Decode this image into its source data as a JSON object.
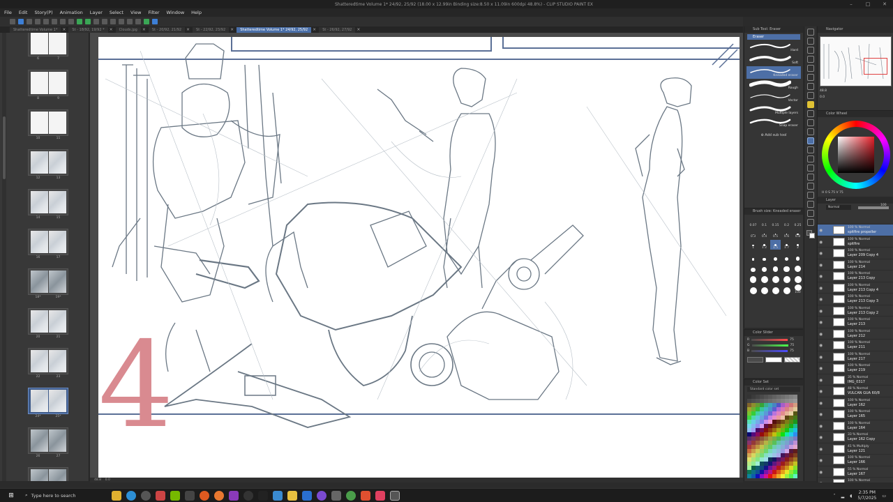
{
  "window": {
    "title": "Shatteredtime Volume 1* 24/92, 25/92 (18.00 x 12.99in Binding size:8.50 x 11.09in 600dpi 48.8%) - CLIP STUDIO PAINT EX"
  },
  "menu": [
    "File",
    "Edit",
    "Story(P)",
    "Animation",
    "Layer",
    "Select",
    "View",
    "Filter",
    "Window",
    "Help"
  ],
  "tabs": [
    {
      "label": "Shatteredtime Volume 1*",
      "active": false
    },
    {
      "label": "St - 18/92, 19/92 *",
      "active": false
    },
    {
      "label": "Clouds.jpg",
      "active": false
    },
    {
      "label": "St - 20/92, 21/92",
      "active": false
    },
    {
      "label": "St - 22/92, 23/92",
      "active": false
    },
    {
      "label": "Shatteredtime Volume 1* 24/92, 25/92",
      "active": true
    },
    {
      "label": "St - 26/92, 27/92",
      "active": false
    }
  ],
  "pages": [
    {
      "labels": [
        "6",
        "7"
      ],
      "style": "blank",
      "active": false
    },
    {
      "labels": [
        "8",
        "9"
      ],
      "style": "blank",
      "active": false
    },
    {
      "labels": [
        "10",
        "11"
      ],
      "style": "blank",
      "active": false
    },
    {
      "labels": [
        "12",
        "13"
      ],
      "style": "sketch",
      "active": false
    },
    {
      "labels": [
        "14",
        "15"
      ],
      "style": "sketch",
      "active": false
    },
    {
      "labels": [
        "16",
        "17"
      ],
      "style": "sketch",
      "active": false
    },
    {
      "labels": [
        "18*",
        "19*"
      ],
      "style": "dark",
      "active": false
    },
    {
      "labels": [
        "20",
        "21"
      ],
      "style": "sketch",
      "active": false
    },
    {
      "labels": [
        "22",
        "23"
      ],
      "style": "sketch",
      "active": false
    },
    {
      "labels": [
        "24*",
        "25*"
      ],
      "style": "sketch",
      "active": true
    },
    {
      "labels": [
        "26",
        "27"
      ],
      "style": "dark",
      "active": false
    },
    {
      "labels": [
        "",
        ""
      ],
      "style": "dark",
      "active": false
    }
  ],
  "canvas": {
    "page_number_mark": "4",
    "status_zoom": "48.8",
    "status_angle": "0.0"
  },
  "subtool": {
    "header": "Sub Tool: Eraser",
    "group": "Eraser",
    "items": [
      {
        "name": "Hard",
        "selected": false
      },
      {
        "name": "Soft",
        "selected": false
      },
      {
        "name": "Kneaded eraser",
        "selected": true
      },
      {
        "name": "Rough",
        "selected": false
      },
      {
        "name": "Vector",
        "selected": false
      },
      {
        "name": "Multiple layers",
        "selected": false
      },
      {
        "name": "Snap eraser",
        "selected": false
      }
    ],
    "add_label": "Add sub tool"
  },
  "brush_size": {
    "header": "Brush size: Kneaded eraser",
    "sizes": [
      "0.07",
      "0.1",
      "0.15",
      "0.2",
      "0.25",
      "0.3",
      "0.4",
      "0.5",
      "0.6",
      "0.8",
      "1",
      "1.2",
      "1.5",
      "1.7",
      "2",
      "2.5",
      "3",
      "4",
      "5",
      "6",
      "7",
      "8",
      "10",
      "12",
      "15",
      "17",
      "20",
      "25",
      "30",
      "40",
      "50",
      "60",
      "70",
      "80",
      "100"
    ],
    "selected": "1.5"
  },
  "color_slider": {
    "header": "Color Slider",
    "rows": [
      {
        "label": "R",
        "value": "75"
      },
      {
        "label": "G",
        "value": "75"
      },
      {
        "label": "B",
        "value": "75"
      }
    ]
  },
  "color_set": {
    "header": "Color Set",
    "set_name": "Standard color set"
  },
  "navigator": {
    "header": "Navigator",
    "zoom": "48.8",
    "angle": "0.0"
  },
  "color_wheel": {
    "header": "Color Wheel",
    "values": "H 0  S 75  V 75"
  },
  "layers": {
    "header": "Layer",
    "blend_mode": "Normal",
    "opacity": "100",
    "items": [
      {
        "mode": "100 % Normal",
        "name": "spitfire propeller",
        "selected": true
      },
      {
        "mode": "100 % Normal",
        "name": "spitfire",
        "selected": false
      },
      {
        "mode": "100 % Normal",
        "name": "Layer 209 Copy 4",
        "selected": false
      },
      {
        "mode": "100 % Normal",
        "name": "Layer 214",
        "selected": false
      },
      {
        "mode": "100 % Normal",
        "name": "Layer 213 Copy",
        "selected": false
      },
      {
        "mode": "100 % Normal",
        "name": "Layer 213 Copy 4",
        "selected": false
      },
      {
        "mode": "100 % Normal",
        "name": "Layer 213 Copy 3",
        "selected": false
      },
      {
        "mode": "100 % Normal",
        "name": "Layer 213 Copy 2",
        "selected": false
      },
      {
        "mode": "100 % Normal",
        "name": "Layer 213",
        "selected": false
      },
      {
        "mode": "100 % Normal",
        "name": "Layer 212",
        "selected": false
      },
      {
        "mode": "100 % Normal",
        "name": "Layer 211",
        "selected": false
      },
      {
        "mode": "100 % Normal",
        "name": "Layer 217",
        "selected": false
      },
      {
        "mode": "100 % Normal",
        "name": "Layer 219",
        "selected": false
      },
      {
        "mode": "35 % Normal",
        "name": "IMG_0317",
        "selected": false
      },
      {
        "mode": "48 % Normal",
        "name": "VULCAN GUA 60/8",
        "selected": false
      },
      {
        "mode": "100 % Normal",
        "name": "Layer 162",
        "selected": false
      },
      {
        "mode": "100 % Normal",
        "name": "Layer 165",
        "selected": false
      },
      {
        "mode": "100 % Normal",
        "name": "Layer 164",
        "selected": false
      },
      {
        "mode": "33 % Normal",
        "name": "Layer 162 Copy",
        "selected": false
      },
      {
        "mode": "41 % Multiply",
        "name": "Layer 121",
        "selected": false
      },
      {
        "mode": "100 % Normal",
        "name": "Layer 166",
        "selected": false
      },
      {
        "mode": "55 % Normal",
        "name": "Layer 167",
        "selected": false
      },
      {
        "mode": "100 % Normal",
        "name": "Layer 168",
        "selected": false
      }
    ]
  },
  "taskbar": {
    "search_placeholder": "Type here to search",
    "time": "2:35 PM",
    "date": "5/7/2025"
  },
  "colors": {
    "accent": "#4d6fa6",
    "panel_border": "#5a6f96",
    "page_number": "#d98a90",
    "sketch": "#6a7784"
  }
}
